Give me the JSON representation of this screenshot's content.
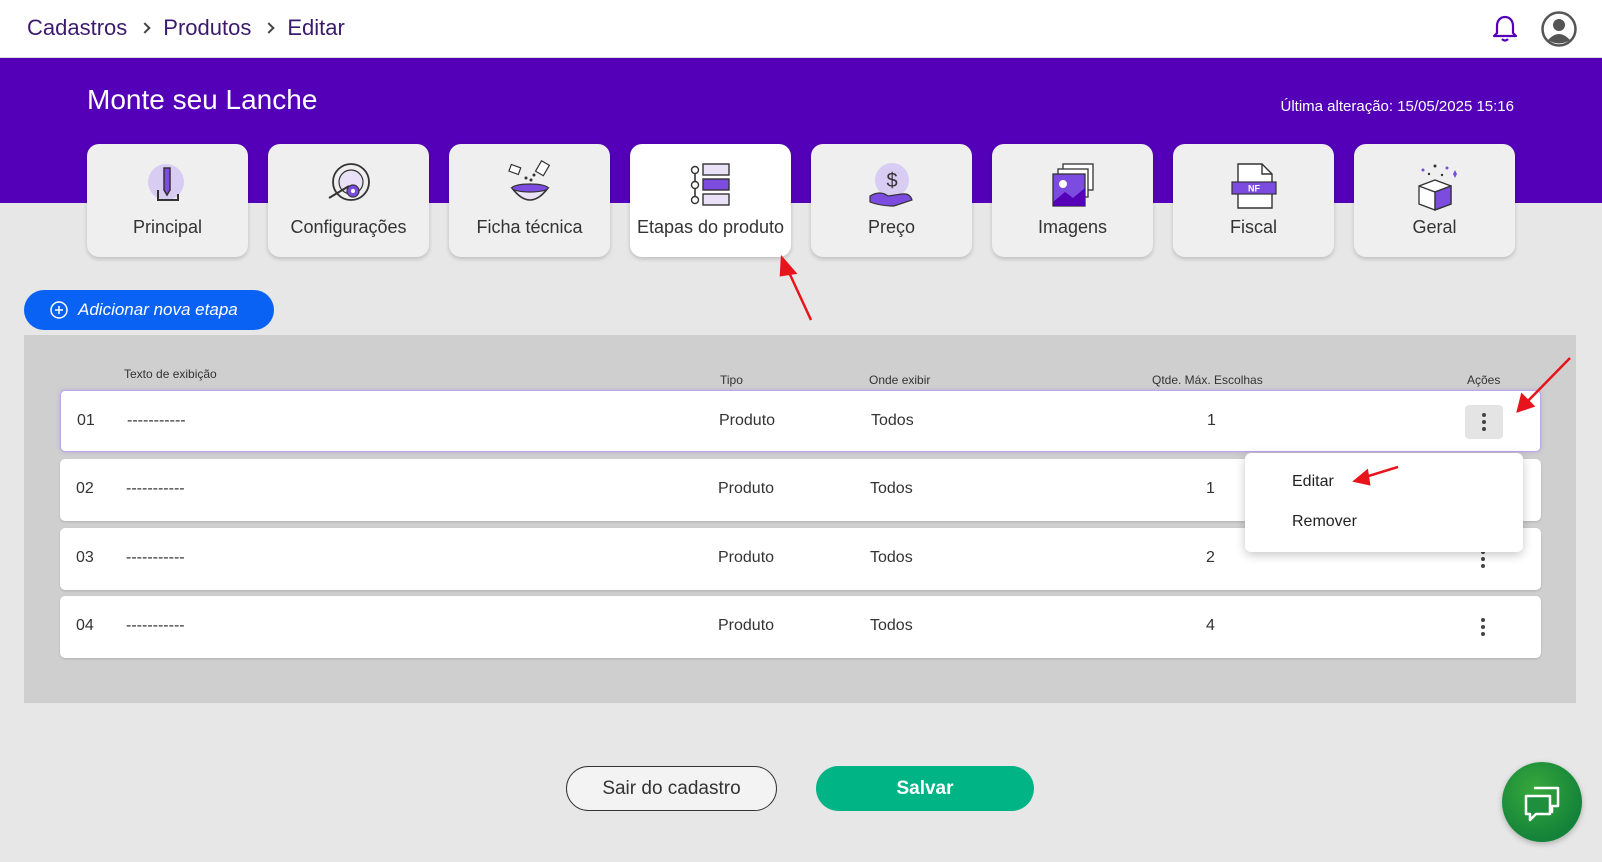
{
  "breadcrumb": {
    "items": [
      "Cadastros",
      "Produtos",
      "Editar"
    ]
  },
  "header": {
    "title": "Monte seu Lanche",
    "last_modified": "Última alteração: 15/05/2025 15:16"
  },
  "tabs": [
    {
      "label": "Principal",
      "icon": "pencil-icon"
    },
    {
      "label": "Configurações",
      "icon": "settings-gear-icon"
    },
    {
      "label": "Ficha técnica",
      "icon": "recipe-bowl-icon"
    },
    {
      "label": "Etapas do produto",
      "icon": "steps-list-icon",
      "active": true
    },
    {
      "label": "Preço",
      "icon": "price-hand-icon"
    },
    {
      "label": "Imagens",
      "icon": "images-icon"
    },
    {
      "label": "Fiscal",
      "icon": "fiscal-nf-icon"
    },
    {
      "label": "Geral",
      "icon": "gift-box-icon"
    }
  ],
  "add_button": {
    "label": "Adicionar nova etapa",
    "icon": "plus-circle-icon"
  },
  "table": {
    "headers": {
      "text": "Texto de exibição",
      "type": "Tipo",
      "where": "Onde exibir",
      "max": "Qtde. Máx. Escolhas",
      "actions": "Ações"
    },
    "rows": [
      {
        "num": "01",
        "text": "-----------",
        "type": "Produto",
        "where": "Todos",
        "max": "1"
      },
      {
        "num": "02",
        "text": "-----------",
        "type": "Produto",
        "where": "Todos",
        "max": "1"
      },
      {
        "num": "03",
        "text": "-----------",
        "type": "Produto",
        "where": "Todos",
        "max": "2"
      },
      {
        "num": "04",
        "text": "-----------",
        "type": "Produto",
        "where": "Todos",
        "max": "4"
      }
    ]
  },
  "action_menu": {
    "edit": "Editar",
    "remove": "Remover"
  },
  "footer": {
    "exit_label": "Sair do cadastro",
    "save_label": "Salvar"
  },
  "colors": {
    "brand_purple": "#5300b8",
    "primary_blue": "#0a62f5",
    "save_green": "#00b486",
    "annotation_red": "#e8141c"
  }
}
